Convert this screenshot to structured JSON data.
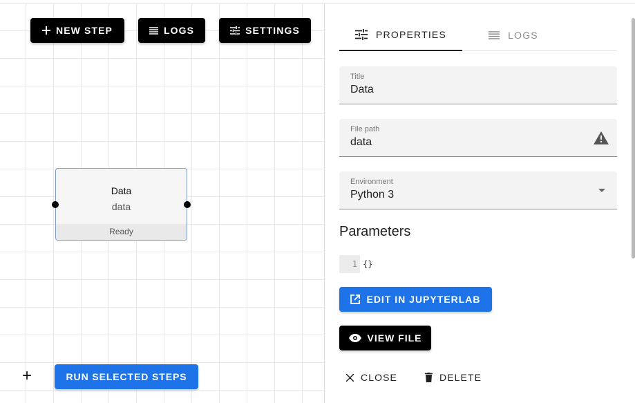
{
  "toolbar": {
    "new_step": "NEW STEP",
    "logs": "LOGS",
    "settings": "SETTINGS"
  },
  "step": {
    "title": "Data",
    "path": "data",
    "status": "Ready"
  },
  "canvas": {
    "add_symbol": "+",
    "run_selected": "RUN SELECTED STEPS"
  },
  "panel": {
    "tabs": [
      {
        "label": "PROPERTIES",
        "icon": "tune-icon",
        "active": true
      },
      {
        "label": "LOGS",
        "icon": "list-icon",
        "active": false
      }
    ],
    "fields": {
      "title": {
        "label": "Title",
        "value": "Data"
      },
      "file_path": {
        "label": "File path",
        "value": "data",
        "icon": "warning-icon"
      },
      "environment": {
        "label": "Environment",
        "value": "Python 3",
        "icon": "dropdown-arrow-icon"
      }
    },
    "parameters": {
      "heading": "Parameters",
      "line_number": "1",
      "code": "{}"
    },
    "buttons": {
      "edit_jupyterlab": "EDIT IN JUPYTERLAB",
      "view_file": "VIEW FILE",
      "close": "CLOSE",
      "delete": "DELETE"
    }
  },
  "colors": {
    "primary": "#1e73e8",
    "dark": "#000000"
  }
}
